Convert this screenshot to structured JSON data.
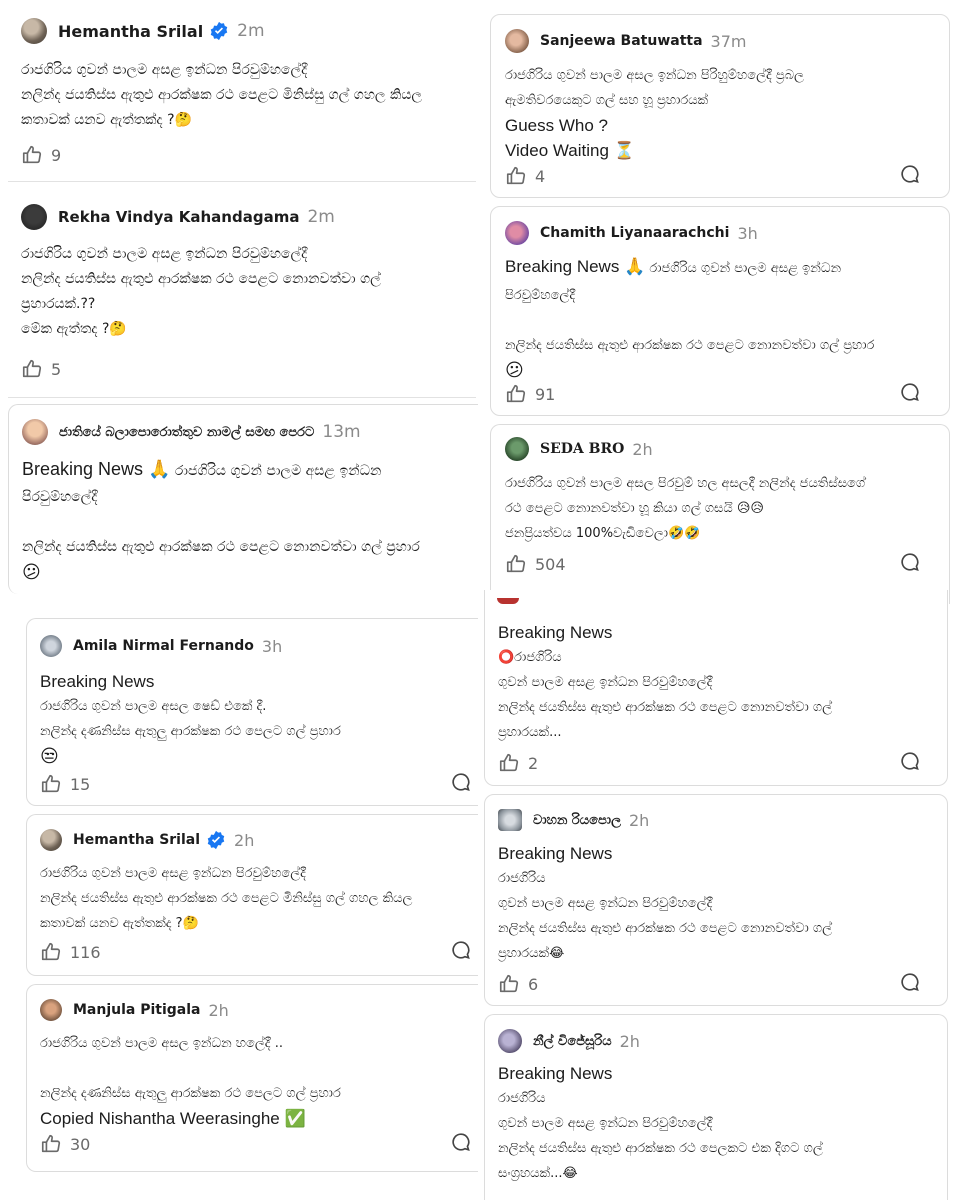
{
  "colors": {
    "verified": "#1877f2",
    "text": "#1c1c1c",
    "muted": "#8a8a8a"
  },
  "posts": [
    {
      "author": "Hemantha Srilal",
      "time": "2m",
      "verified": true,
      "avatar_icon": "user-avatar",
      "lines": [
        "රාජගිරිය ගුවන් පාලම අසළ ඉන්ධන පිරවුම්හලේදී",
        " නලින්ද ජයතිස්ස ඇතුළු ආරක්ෂක රථ පෙළට මිනිස්සු ගල් ගහල කියල",
        "කතාවක් යනව ඇත්තක්ද ?🤔"
      ],
      "likes": "9"
    },
    {
      "author": "Rekha Vindya Kahandagama",
      "time": "2m",
      "lines": [
        "රාජගිරිය ගුවන් පාලම අසළ ඉන්ධන පිරවුම්හලේදී",
        " නලින්ද ජයතිස්ස ඇතුළු ආරක්ෂක රථ පෙළට නොනවත්වා ගල්",
        "ප්‍රහාරයක්.??",
        "මේක ඇත්තද ?🤔"
      ],
      "likes": "5"
    },
    {
      "author": "ජාතියේ බලාපොරොත්තුව  නාමල් සමඟ පෙරට",
      "time": "13m",
      "headline": "Breaking News 🙏",
      "headline_rest": " රාජගිරිය ගුවන් පාලම අසළ ඉන්ධන",
      "lines": [
        "පිරවුම්හලේදී",
        "",
        "නලින්ද ජයතිස්ස ඇතුළු ආරක්ෂක රථ පෙළට නොනවත්වා ගල් ප්‍රහාර",
        "😕"
      ]
    },
    {
      "author": "Sanjeewa Batuwatta",
      "time": "37m",
      "lines": [
        "රාජගිරිය ගුවන් පාලම අසල ඉන්ධන පිරිහුම්හලේදී ප්‍රබල",
        "ඇමතිවරයෙකුට ගල් සහ හූ ප්‍රහාරයක්"
      ],
      "en_lines": [
        "Guess Who ?",
        "Video Waiting ⏳"
      ],
      "likes": "4"
    },
    {
      "author": "Chamith Liyanaarachchi",
      "time": "3h",
      "headline": "Breaking News 🙏",
      "headline_rest": " රාජගිරිය ගුවන් පාලම අසළ ඉන්ධන",
      "lines": [
        "පිරවුම්හලේදී",
        "",
        "නලින්ද ජයතිස්ස ඇතුළු ආරක්ෂක රථ පෙළට නොනවත්වා ගල් ප්‍රහාර",
        "😕"
      ],
      "likes": "91"
    },
    {
      "author": "SEDA BRO",
      "time": "2h",
      "lines": [
        "රාජගිරිය ගුවන් පාලම අසල පිරවුම් හල අසලදී නලින්ද ජයතිස්සගේ",
        "රථ පෙළට  නොනවත්වා හූ කියා ගල් ගසයි 😥😥",
        "ජනප්‍රියත්වය 100%වැඩිවෙලා🤣🤣"
      ],
      "likes": "504"
    },
    {
      "author": "Amila Nirmal Fernando",
      "time": "3h",
      "headline": "Breaking News",
      "lines": [
        "රාජගිරිය ගුවන් පාලම අසල ෂෙඩ් එකේ දී.",
        "නලින්ද දණනිස්ස ඇතුලු ආරක්ෂක රථ පෙලට ගල් ප්‍රහාර",
        "😒"
      ],
      "likes": "15"
    },
    {
      "author": "Hemantha Srilal",
      "time": "2h",
      "verified": true,
      "lines": [
        "රාජගිරිය ගුවන් පාලම අසළ ඉන්ධන පිරවුම්හලේදී",
        " නලින්ද ජයතිස්ස ඇතුළු ආරක්ෂක රථ පෙළට මිනිස්සු ගල් ගහල කියල",
        "කතාවක් යනව ඇත්තක්ද ?🤔"
      ],
      "likes": "116"
    },
    {
      "author": "Manjula Pitigala",
      "time": "2h",
      "lines": [
        "රාජගිරිය ගුවන් පාලම අසල ඉන්ධන හලේදී ..",
        "",
        "නලින්ද දණනිස්ස ඇතුලු ආරක්ෂක රථ පෙලට ගල් ප්‍රහාර"
      ],
      "en_lines": [
        "Copied  Nishantha Weerasinghe ✅"
      ],
      "likes": "30"
    },
    {
      "headline": "Breaking News",
      "lines": [
        "⭕රාජගිරිය",
        "ගුවන් පාලම අසළ ඉන්ධන පිරවුම්හලේදී",
        " නලින්ද ජයතිස්ස ඇතුළු ආරක්ෂක රථ පෙළට නොනවත්වා ගල්",
        "ප්‍රහාරයක්..."
      ],
      "likes": "2"
    },
    {
      "author": "වාහන රියපොල",
      "time": "2h",
      "headline": "Breaking News",
      "lines": [
        "රාජගිරිය",
        "ගුවන් පාලම අසළ ඉන්ධන පිරවුම්හලේදී",
        " නලින්ද ජයතිස්ස ඇතුළු ආරක්ෂක රථ පෙළට නොනවත්වා ගල්",
        "ප්‍රහාරයක්😂"
      ],
      "likes": "6"
    },
    {
      "author": "නීල් විජේසූරිය",
      "time": "2h",
      "headline": "Breaking News",
      "lines": [
        "රාජගිරිය",
        "ගුවන් පාලම අසළ ඉන්ධන පිරවුම්හලේදී",
        " නලින්ද ජයතිස්ස ඇතුළු ආරක්ෂක රථ පෙලකට එක දිගට ගල්",
        "සංග්‍රහයක්...😂"
      ]
    }
  ]
}
